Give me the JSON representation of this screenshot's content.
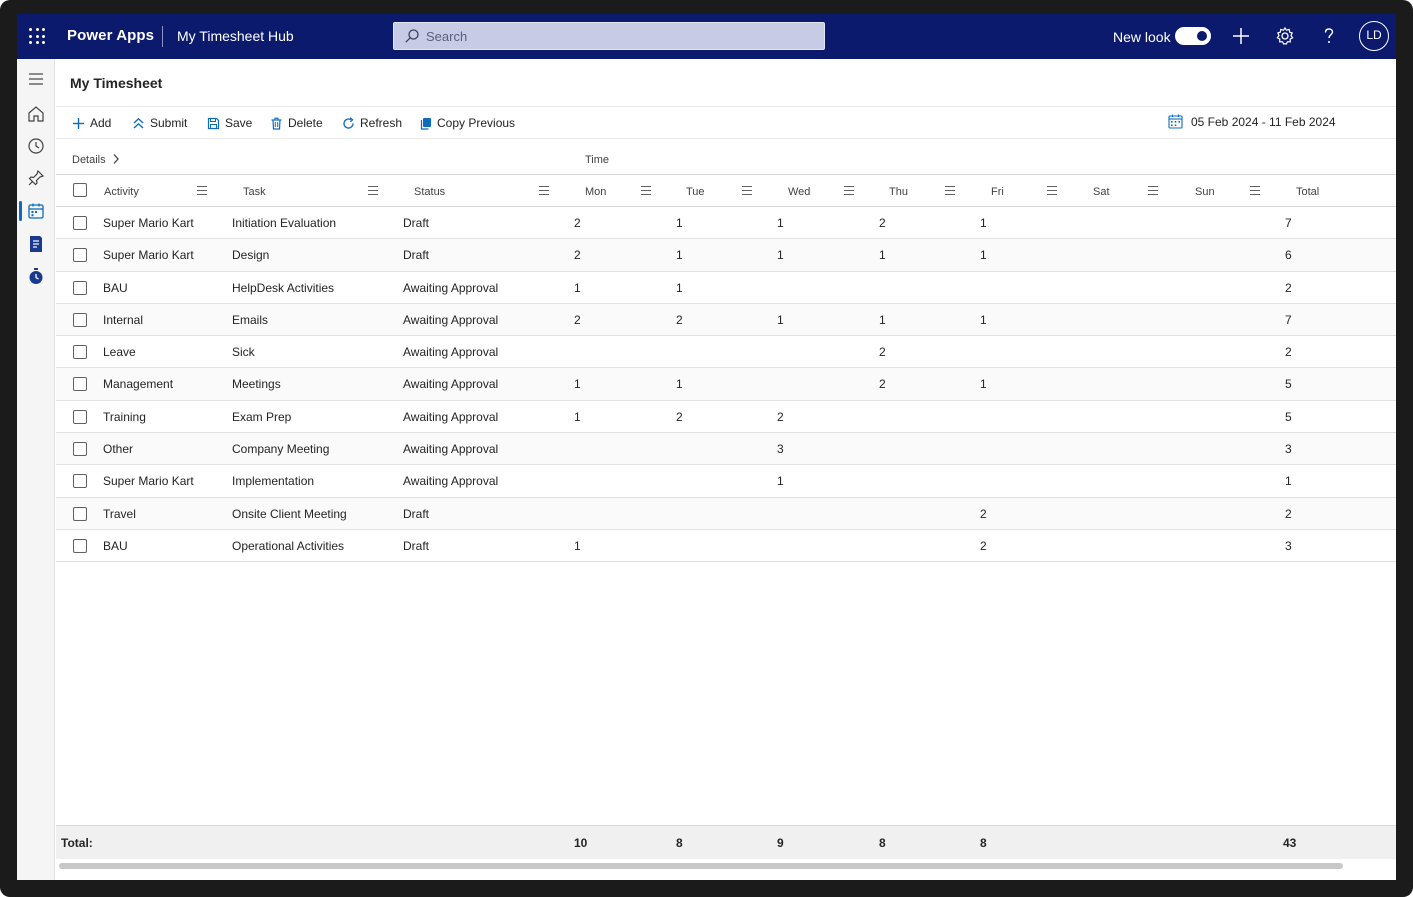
{
  "topbar": {
    "brand": "Power Apps",
    "app_name": "My Timesheet Hub",
    "search_placeholder": "Search",
    "new_look_label": "New look",
    "new_look_on": true,
    "avatar_initials": "LD"
  },
  "sidebar": {
    "items": [
      {
        "icon": "hamburger-icon"
      },
      {
        "icon": "home-icon"
      },
      {
        "icon": "clock-icon"
      },
      {
        "icon": "pin-icon"
      },
      {
        "icon": "timesheet-icon",
        "active": true
      },
      {
        "icon": "report-icon"
      },
      {
        "icon": "stopwatch-icon"
      }
    ]
  },
  "page": {
    "title": "My Timesheet"
  },
  "commands": {
    "add": "Add",
    "submit": "Submit",
    "save": "Save",
    "delete": "Delete",
    "refresh": "Refresh",
    "copy_previous": "Copy Previous",
    "date_range": "05 Feb 2024 - 11 Feb 2024"
  },
  "groups": {
    "details": "Details",
    "time": "Time"
  },
  "columns": {
    "activity": "Activity",
    "task": "Task",
    "status": "Status",
    "mon": "Mon",
    "tue": "Tue",
    "wed": "Wed",
    "thu": "Thu",
    "fri": "Fri",
    "sat": "Sat",
    "sun": "Sun",
    "total": "Total"
  },
  "rows": [
    {
      "activity": "Super Mario Kart",
      "task": "Initiation Evaluation",
      "status": "Draft",
      "mon": "2",
      "tue": "1",
      "wed": "1",
      "thu": "2",
      "fri": "1",
      "sat": "",
      "sun": "",
      "total": "7"
    },
    {
      "activity": "Super Mario Kart",
      "task": "Design",
      "status": "Draft",
      "mon": "2",
      "tue": "1",
      "wed": "1",
      "thu": "1",
      "fri": "1",
      "sat": "",
      "sun": "",
      "total": "6"
    },
    {
      "activity": "BAU",
      "task": "HelpDesk Activities",
      "status": "Awaiting Approval",
      "mon": "1",
      "tue": "1",
      "wed": "",
      "thu": "",
      "fri": "",
      "sat": "",
      "sun": "",
      "total": "2"
    },
    {
      "activity": "Internal",
      "task": "Emails",
      "status": "Awaiting Approval",
      "mon": "2",
      "tue": "2",
      "wed": "1",
      "thu": "1",
      "fri": "1",
      "sat": "",
      "sun": "",
      "total": "7"
    },
    {
      "activity": "Leave",
      "task": "Sick",
      "status": "Awaiting Approval",
      "mon": "",
      "tue": "",
      "wed": "",
      "thu": "2",
      "fri": "",
      "sat": "",
      "sun": "",
      "total": "2"
    },
    {
      "activity": "Management",
      "task": "Meetings",
      "status": "Awaiting Approval",
      "mon": "1",
      "tue": "1",
      "wed": "",
      "thu": "2",
      "fri": "1",
      "sat": "",
      "sun": "",
      "total": "5"
    },
    {
      "activity": "Training",
      "task": "Exam Prep",
      "status": "Awaiting Approval",
      "mon": "1",
      "tue": "2",
      "wed": "2",
      "thu": "",
      "fri": "",
      "sat": "",
      "sun": "",
      "total": "5"
    },
    {
      "activity": "Other",
      "task": "Company Meeting",
      "status": "Awaiting Approval",
      "mon": "",
      "tue": "",
      "wed": "3",
      "thu": "",
      "fri": "",
      "sat": "",
      "sun": "",
      "total": "3"
    },
    {
      "activity": "Super Mario Kart",
      "task": "Implementation",
      "status": "Awaiting Approval",
      "mon": "",
      "tue": "",
      "wed": "1",
      "thu": "",
      "fri": "",
      "sat": "",
      "sun": "",
      "total": "1"
    },
    {
      "activity": "Travel",
      "task": "Onsite Client Meeting",
      "status": "Draft",
      "mon": "",
      "tue": "",
      "wed": "",
      "thu": "",
      "fri": "2",
      "sat": "",
      "sun": "",
      "total": "2"
    },
    {
      "activity": "BAU",
      "task": "Operational Activities",
      "status": "Draft",
      "mon": "1",
      "tue": "",
      "wed": "",
      "thu": "",
      "fri": "2",
      "sat": "",
      "sun": "",
      "total": "3"
    }
  ],
  "totals": {
    "label": "Total:",
    "mon": "10",
    "tue": "8",
    "wed": "9",
    "thu": "8",
    "fri": "8",
    "sat": "",
    "sun": "",
    "total": "43"
  },
  "colors": {
    "topbar_bg": "#0c1a6e",
    "accent": "#0f6cbd"
  }
}
